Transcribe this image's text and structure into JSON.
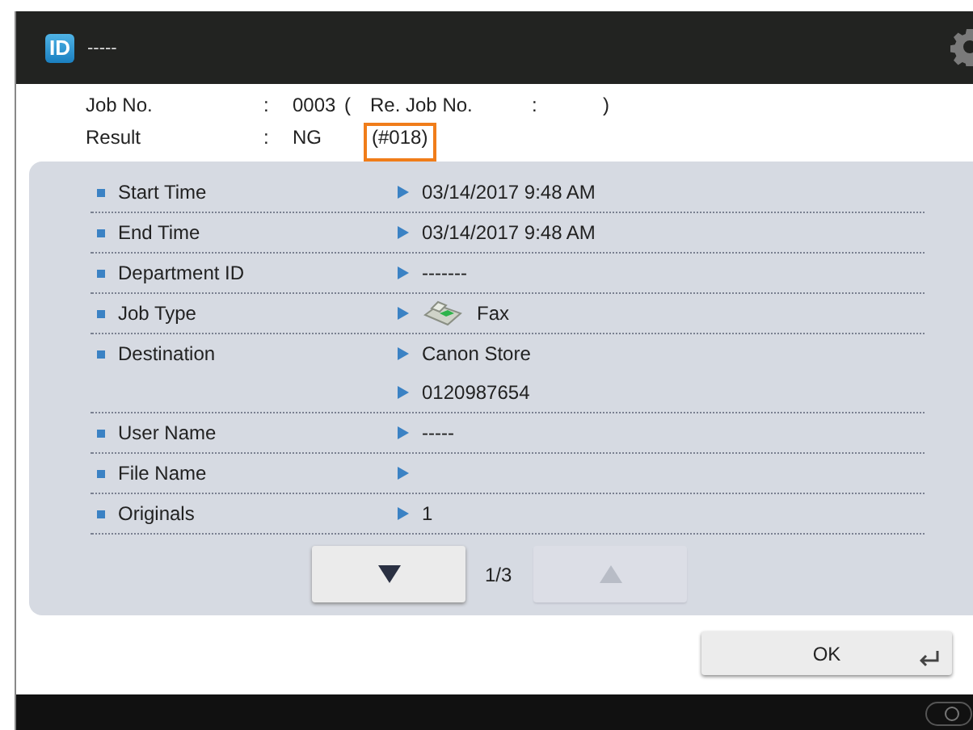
{
  "header": {
    "badge": "ID",
    "user": "-----"
  },
  "job": {
    "job_no_label": "Job No.",
    "job_no_sep": ":",
    "job_no": "0003",
    "re_open": "(",
    "re_label": "Re. Job No.",
    "re_sep": ":",
    "re_close": ")",
    "result_label": "Result",
    "result_sep": ":",
    "result": "NG",
    "code": "(#018)",
    "code_highlighted": true
  },
  "details": [
    {
      "label": "Start Time",
      "values": [
        {
          "text": "03/14/2017 9:48 AM"
        }
      ]
    },
    {
      "label": "End Time",
      "values": [
        {
          "text": "03/14/2017 9:48 AM"
        }
      ]
    },
    {
      "label": "Department ID",
      "values": [
        {
          "text": "-------"
        }
      ]
    },
    {
      "label": "Job Type",
      "values": [
        {
          "text": "Fax",
          "kind": "fax"
        }
      ]
    },
    {
      "label": "Destination",
      "values": [
        {
          "text": "Canon Store"
        },
        {
          "text": "0120987654"
        }
      ]
    },
    {
      "label": "User Name",
      "values": [
        {
          "text": "-----"
        }
      ]
    },
    {
      "label": "File Name"
    },
    {
      "label": "Originals",
      "values": [
        {
          "text": "1"
        }
      ]
    }
  ],
  "pager": {
    "page": "1/3",
    "down_disabled": false,
    "up_disabled": true
  },
  "ok_button": "OK"
}
